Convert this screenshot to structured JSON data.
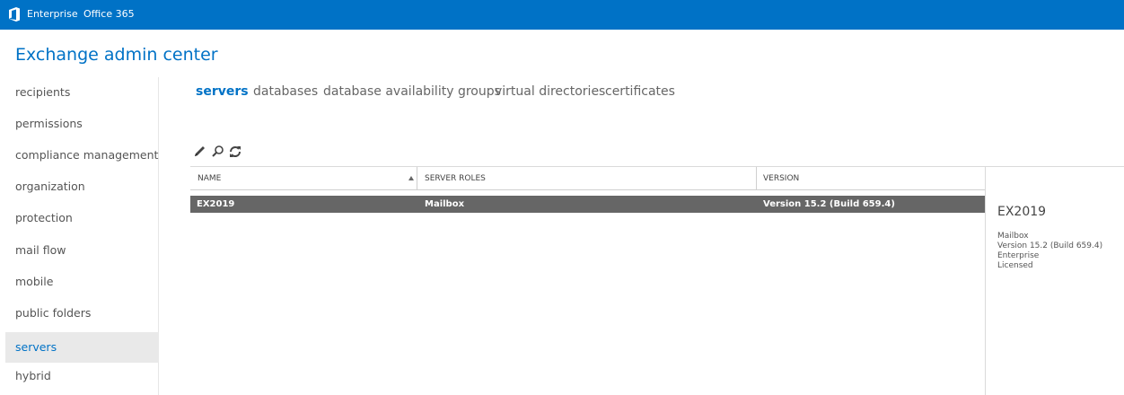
{
  "topbar": {
    "logo_icon": "office-logo-icon",
    "links": [
      "Enterprise",
      "Office 365"
    ]
  },
  "app": {
    "title": "Exchange admin center"
  },
  "sidebar": {
    "items": [
      {
        "label": "recipients",
        "selected": false
      },
      {
        "label": "permissions",
        "selected": false
      },
      {
        "label": "compliance management",
        "selected": false
      },
      {
        "label": "organization",
        "selected": false
      },
      {
        "label": "protection",
        "selected": false
      },
      {
        "label": "mail flow",
        "selected": false
      },
      {
        "label": "mobile",
        "selected": false
      },
      {
        "label": "public folders",
        "selected": false
      },
      {
        "label": "servers",
        "selected": true
      },
      {
        "label": "hybrid",
        "selected": false
      }
    ]
  },
  "tabs": [
    {
      "label": "servers",
      "active": true
    },
    {
      "label": "databases",
      "active": false
    },
    {
      "label": "database availability groups",
      "active": false
    },
    {
      "label": "virtual directories",
      "active": false
    },
    {
      "label": "certificates",
      "active": false
    }
  ],
  "toolbar": {
    "icons": [
      "edit-icon",
      "search-icon",
      "refresh-icon"
    ]
  },
  "grid": {
    "columns": [
      {
        "label": "NAME",
        "sorted": "ascending"
      },
      {
        "label": "SERVER ROLES"
      },
      {
        "label": "VERSION"
      }
    ],
    "rows": [
      {
        "name": "EX2019",
        "roles": "Mailbox",
        "version": "Version 15.2 (Build 659.4)",
        "selected": true
      }
    ]
  },
  "details": {
    "title": "EX2019",
    "lines": [
      "Mailbox",
      "Version 15.2 (Build 659.4)",
      "Enterprise",
      "Licensed"
    ]
  },
  "colors": {
    "brand": "#0072c6",
    "selected_row": "#666666",
    "selected_nav": "#e9e9e9"
  }
}
